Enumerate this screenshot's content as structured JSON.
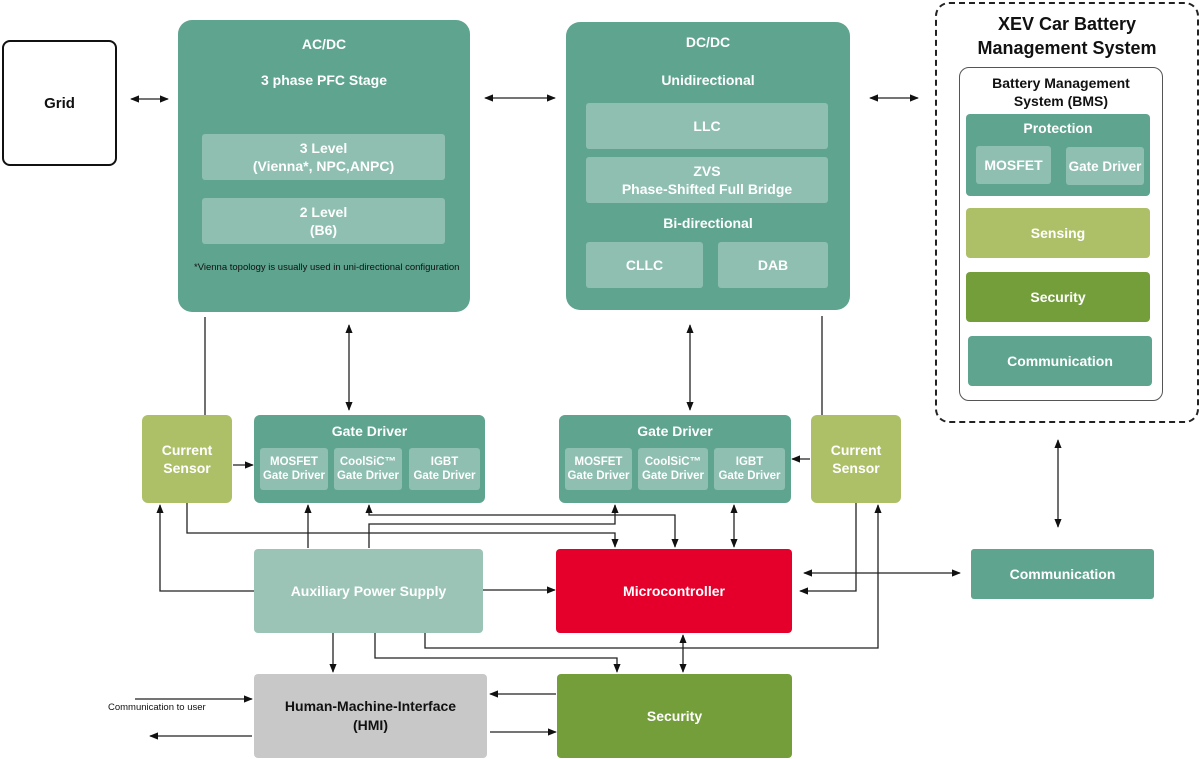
{
  "grid": {
    "label": "Grid"
  },
  "acdc": {
    "title": "AC/DC",
    "subtitle": "3 phase PFC Stage",
    "options": [
      "3 Level\n(Vienna*, NPC,ANPC)",
      "2 Level\n(B6)"
    ],
    "option1_line1": "3 Level",
    "option1_line2": "(Vienna*, NPC,ANPC)",
    "option2_line1": "2 Level",
    "option2_line2": "(B6)",
    "footnote": "*Vienna topology is usually used in uni-directional configuration"
  },
  "dcdc": {
    "title": "DC/DC",
    "unidirectional_label": "Unidirectional",
    "llc": "LLC",
    "zvs_line1": "ZVS",
    "zvs_line2": "Phase-Shifted Full Bridge",
    "bidirectional_label": "Bi-directional",
    "cllc": "CLLC",
    "dab": "DAB"
  },
  "xev": {
    "title_line1": "XEV Car Battery",
    "title_line2": "Management System",
    "bms_title_line1": "Battery Management",
    "bms_title_line2": "System (BMS)",
    "protection": "Protection",
    "mosfet": "MOSFET",
    "gate_driver": "Gate Driver",
    "sensing": "Sensing",
    "security": "Security",
    "communication": "Communication"
  },
  "gate_driver_left": {
    "title": "Gate Driver",
    "items": [
      {
        "line1": "MOSFET",
        "line2": "Gate Driver"
      },
      {
        "line1": "CoolSiC™",
        "line2": "Gate Driver"
      },
      {
        "line1": "IGBT",
        "line2": "Gate Driver"
      }
    ]
  },
  "gate_driver_right": {
    "title": "Gate Driver",
    "items": [
      {
        "line1": "MOSFET",
        "line2": "Gate Driver"
      },
      {
        "line1": "CoolSiC™",
        "line2": "Gate Driver"
      },
      {
        "line1": "IGBT",
        "line2": "Gate Driver"
      }
    ]
  },
  "current_sensor_left": {
    "line1": "Current",
    "line2": "Sensor"
  },
  "current_sensor_right": {
    "line1": "Current",
    "line2": "Sensor"
  },
  "aux_power": {
    "label": "Auxiliary Power Supply"
  },
  "microcontroller": {
    "label": "Microcontroller"
  },
  "communication": {
    "label": "Communication"
  },
  "hmi": {
    "line1": "Human-Machine-Interface",
    "line2": "(HMI)"
  },
  "security": {
    "label": "Security"
  },
  "comm_to_user": {
    "label": "Communication to user"
  },
  "colors": {
    "teal": "#5ea48e",
    "teal_light": "#9bc4b7",
    "lime": "#adc068",
    "green": "#749e3a",
    "red": "#e4002b",
    "gray": "#c8c8c8"
  }
}
